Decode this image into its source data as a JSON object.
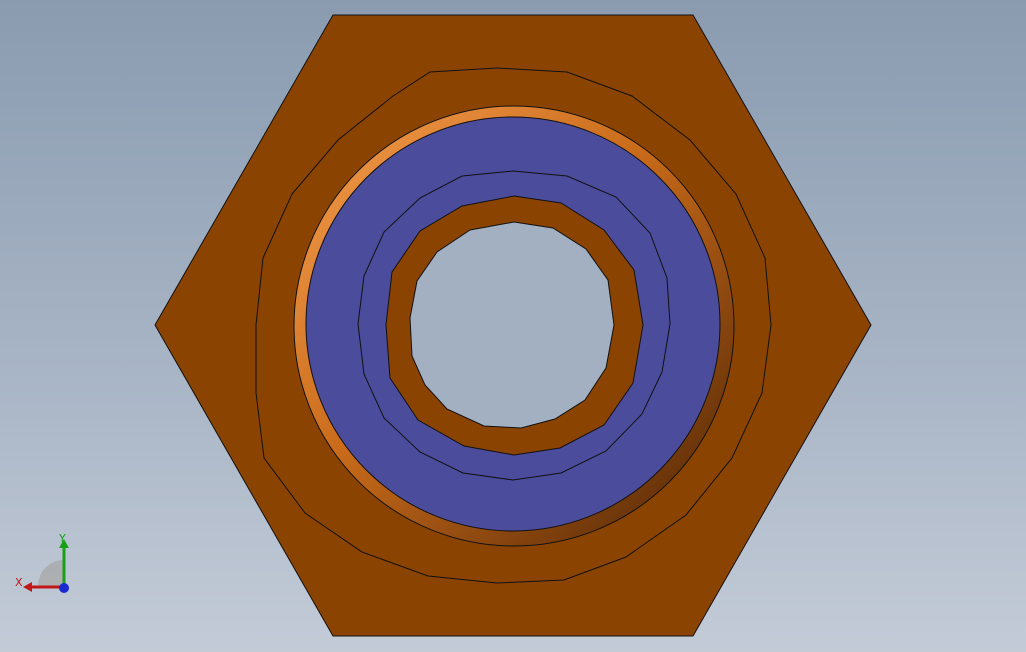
{
  "viewport": {
    "background_top": "#8a9bb0",
    "background_bottom": "#c3cbd7"
  },
  "model": {
    "part": "hex-nut-fitting",
    "view": "top",
    "colors": {
      "hex_body": "#8b4302",
      "seal_ring": "#4b4c9c",
      "washer_highlight": "#f08a30",
      "washer_shadow": "#5a2a05",
      "edge": "#111111"
    }
  },
  "triad": {
    "x_label": "X",
    "y_label": "Y",
    "x_color": "#c01818",
    "y_color": "#18a018",
    "z_color": "#1a2ad0"
  }
}
